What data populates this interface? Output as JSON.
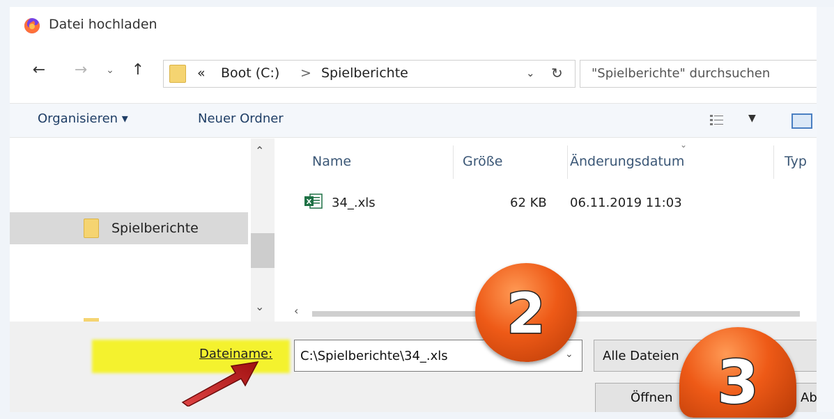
{
  "window": {
    "title": "Datei hochladen"
  },
  "address": {
    "prefix": "«",
    "drive": "Boot (C:)",
    "separator": ">",
    "folder": "Spielberichte"
  },
  "search": {
    "placeholder": "\"Spielberichte\" durchsuchen"
  },
  "toolbar": {
    "organize_label": "Organisieren ▾",
    "new_folder_label": "Neuer Ordner"
  },
  "nav_pane": {
    "selected_folder": "Spielberichte"
  },
  "file_list": {
    "columns": [
      "Name",
      "Größe",
      "Änderungsdatum",
      "Typ"
    ],
    "rows": [
      {
        "name": "34_.xls",
        "size": "62 KB",
        "modified": "06.11.2019 11:03"
      }
    ]
  },
  "bottom": {
    "filename_label": "Dateiname:",
    "filename_value": "C:\\Spielberichte\\34_.xls",
    "file_type": "Alle Dateien",
    "open_label": "Öffnen",
    "cancel_label": "Abbrechen"
  },
  "annotations": {
    "step_2": "2",
    "step_3": "3",
    "highlight_color": "#f4f22e",
    "badge_color": "#ee5a17"
  },
  "colors": {
    "folder": "#f5d471",
    "excel": "#1e7145",
    "link_text": "#1f3e66"
  }
}
